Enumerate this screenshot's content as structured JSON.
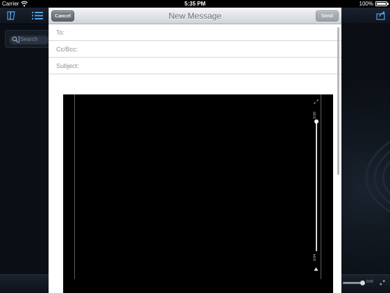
{
  "status_bar": {
    "carrier": "Carrier",
    "time": "5:35 PM",
    "battery": "100%",
    "icons": [
      "wifi-icon",
      "battery-icon"
    ]
  },
  "background_app": {
    "toolbar_icons": [
      "library-icon",
      "list-icon",
      "share-icon"
    ],
    "search": {
      "placeholder": "Search"
    },
    "player": {
      "time": "0:00"
    }
  },
  "compose": {
    "title": "New Message",
    "cancel_label": "Cancel",
    "send_label": "Send",
    "fields": [
      {
        "label": "To:",
        "value": ""
      },
      {
        "label": "Cc/Bcc:",
        "value": ""
      },
      {
        "label": "Subject:",
        "value": ""
      }
    ],
    "embedded_image": {
      "slider_top_label": "0:00",
      "slider_bottom_label": "0:04",
      "colors": {
        "background": "#000000"
      }
    }
  },
  "colors": {
    "nav_gradient_top": "#f4f5f7",
    "nav_gradient_bottom": "#cfd3d9",
    "title_text": "#6b7077",
    "label_text": "#8e8e8e",
    "background_app": "#0b0f15"
  }
}
